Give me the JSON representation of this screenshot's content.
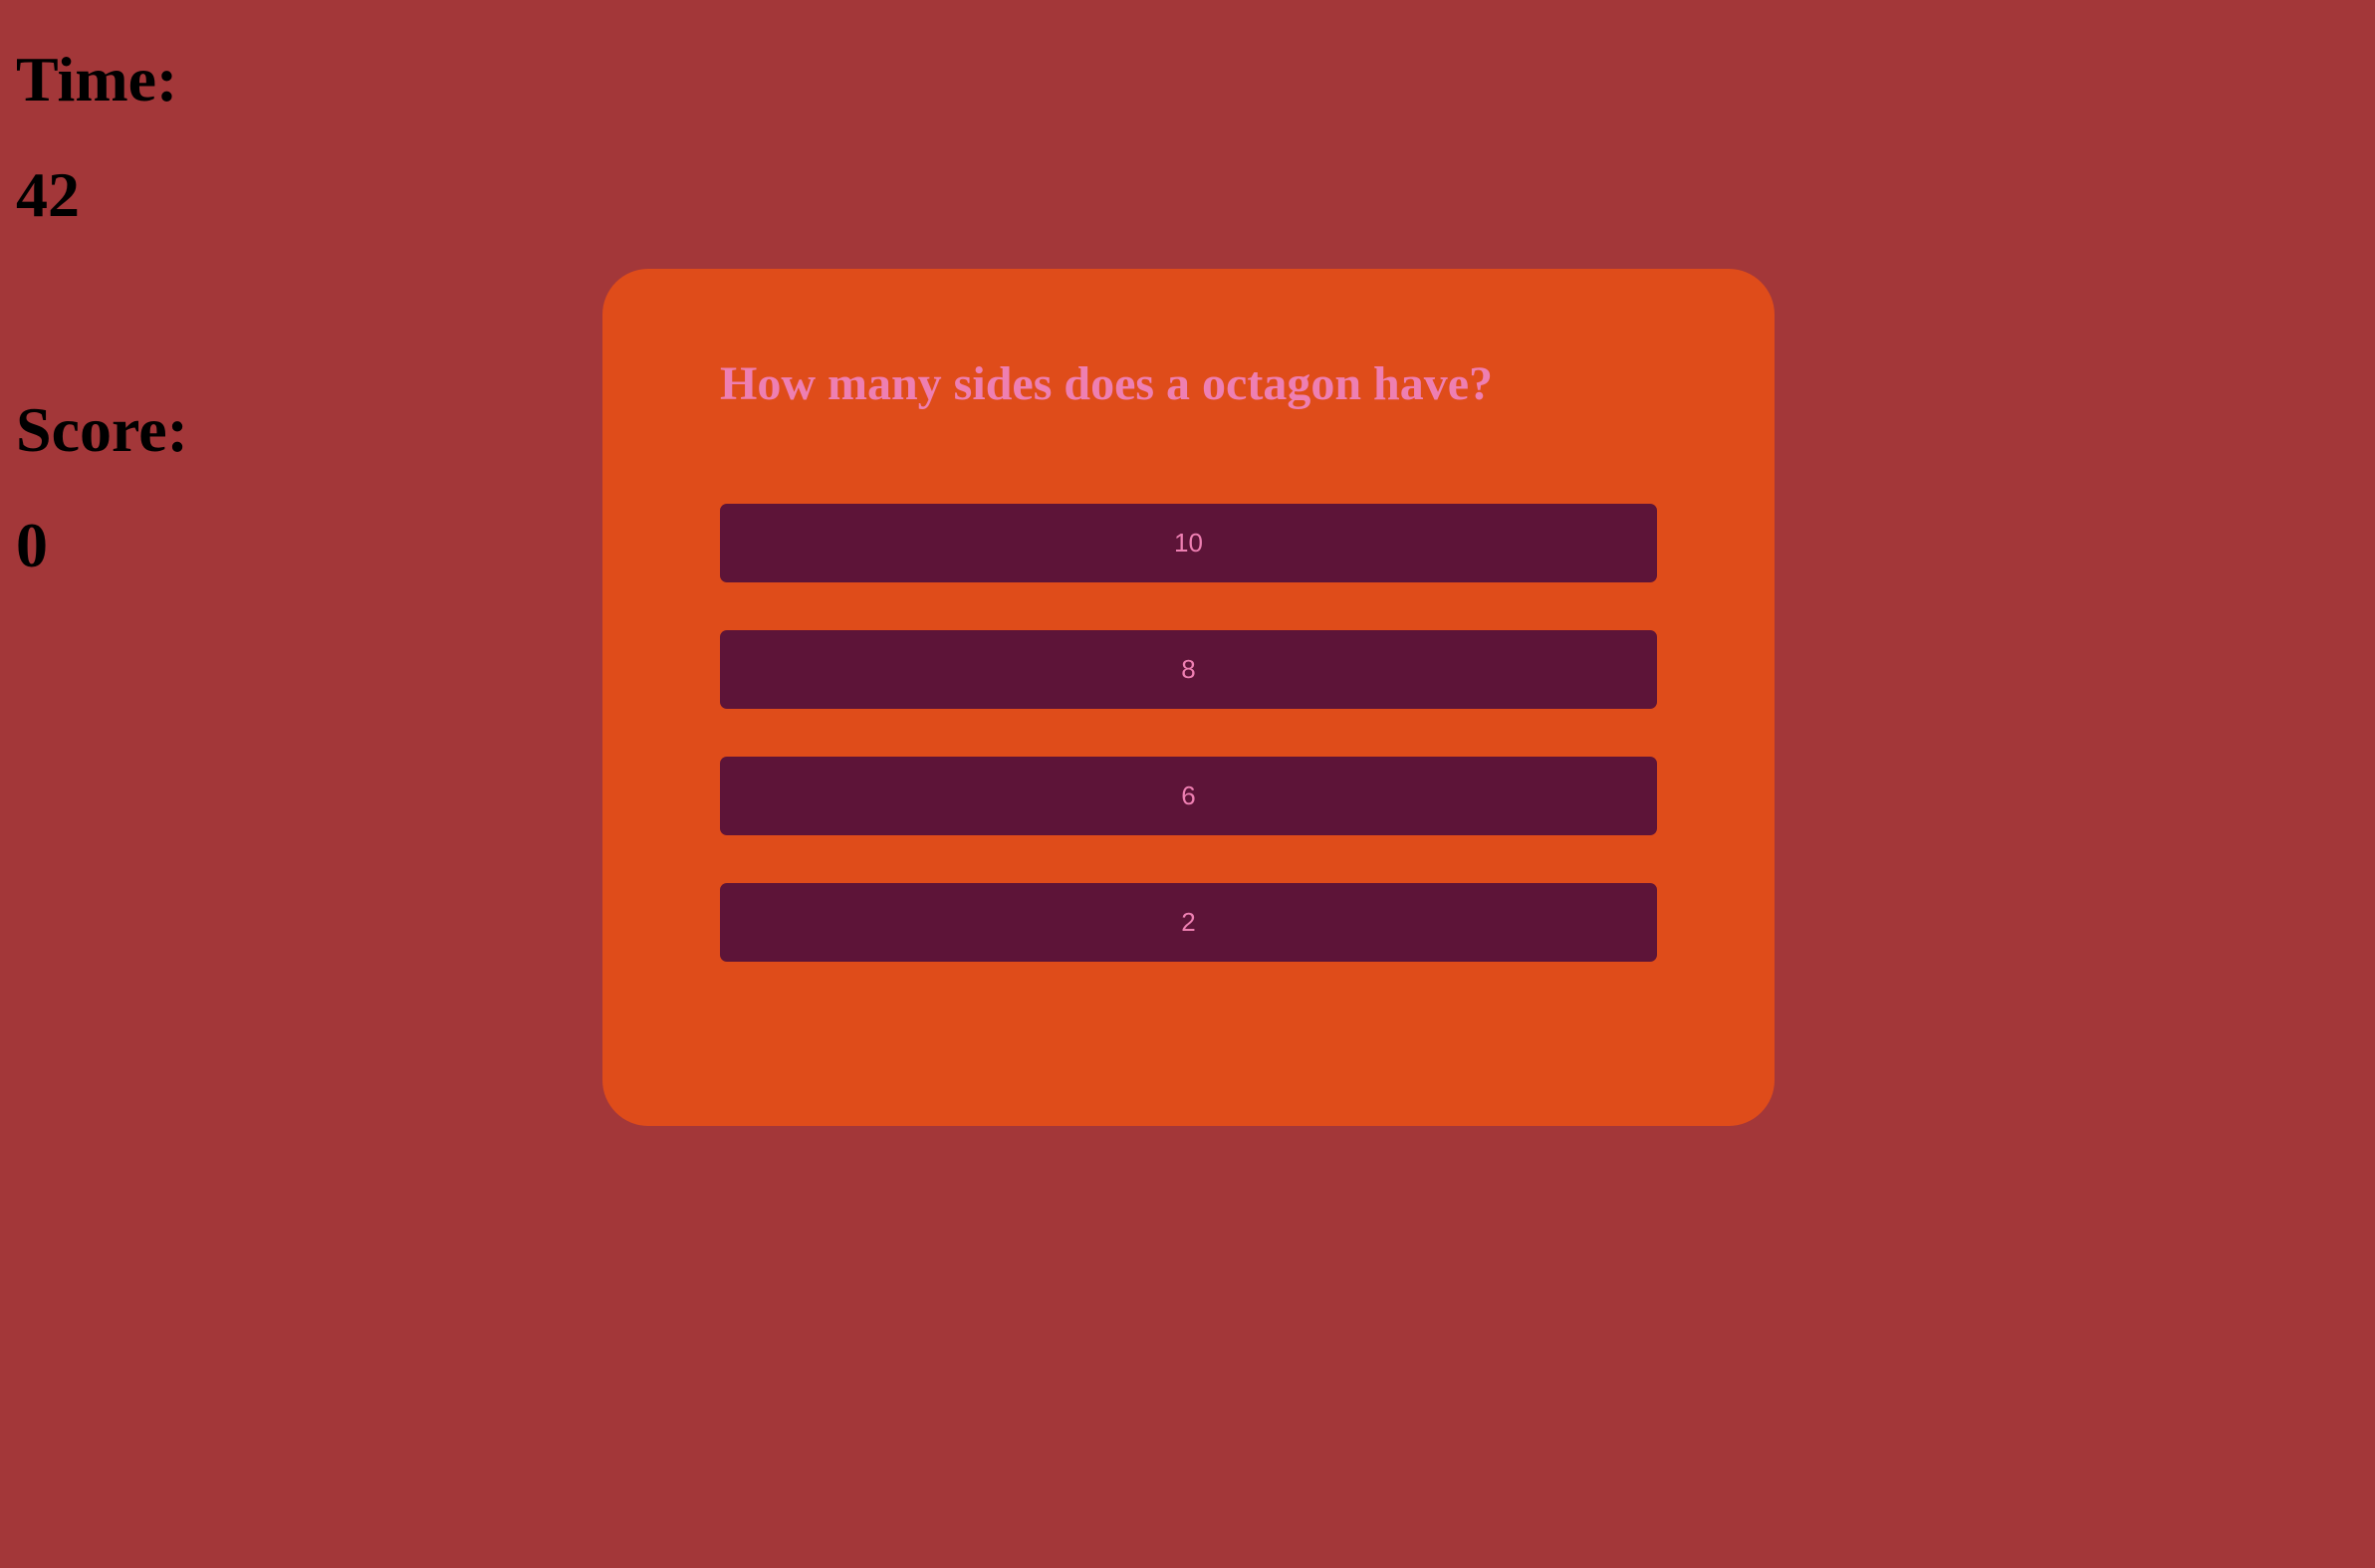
{
  "stats": {
    "time_label": "Time:",
    "time_value": "42",
    "score_label": "Score:",
    "score_value": "0"
  },
  "quiz": {
    "question": "How many sides does a octagon have?",
    "answers": [
      "10",
      "8",
      "6",
      "2"
    ]
  },
  "colors": {
    "page_background": "#a33739",
    "card_background": "#df4c1a",
    "button_background": "#5d1438",
    "accent_text": "#ee7fb2"
  }
}
